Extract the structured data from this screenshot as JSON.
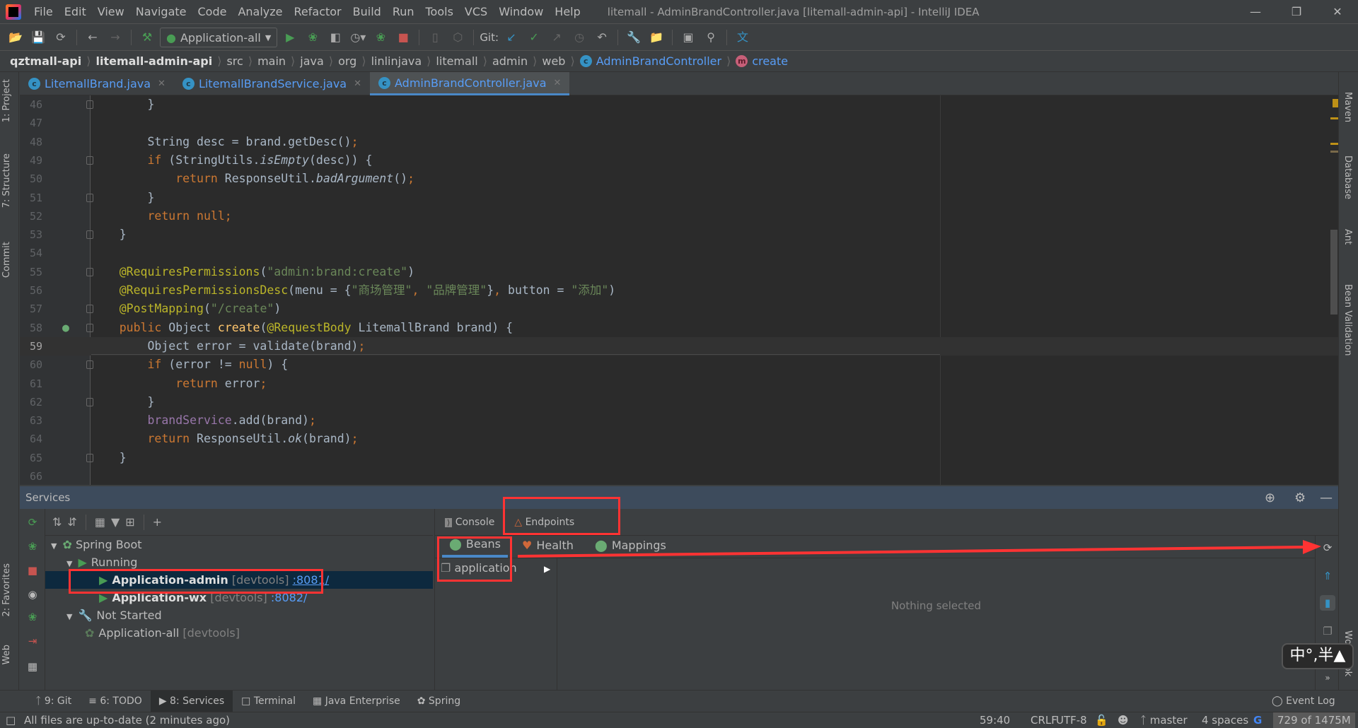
{
  "menubar": {
    "items": [
      "File",
      "Edit",
      "View",
      "Navigate",
      "Code",
      "Analyze",
      "Refactor",
      "Build",
      "Run",
      "Tools",
      "VCS",
      "Window",
      "Help"
    ],
    "title": "litemall - AdminBrandController.java [litemall-admin-api] - IntelliJ IDEA"
  },
  "toolbar": {
    "run_config": "Application-all",
    "git_label": "Git:"
  },
  "breadcrumb": [
    "qztmall-api",
    "litemall-admin-api",
    "src",
    "main",
    "java",
    "org",
    "linlinjava",
    "litemall",
    "admin",
    "web",
    "AdminBrandController",
    "create"
  ],
  "tabs": [
    {
      "label": "LitemallBrand.java"
    },
    {
      "label": "LitemallBrandService.java"
    },
    {
      "label": "AdminBrandController.java",
      "active": true
    }
  ],
  "left_strip": [
    "1: Project",
    "7: Structure",
    "Commit",
    "2: Favorites",
    "Web"
  ],
  "right_strip": [
    "Maven",
    "Database",
    "Ant",
    "Bean Validation",
    "Wordbook"
  ],
  "editor": {
    "current_line": 59,
    "lines": [
      {
        "n": 46,
        "t": [
          [
            "        }",
            ""
          ]
        ]
      },
      {
        "n": 47,
        "t": []
      },
      {
        "n": 48,
        "t": [
          [
            "        String desc = brand.getDesc()",
            ""
          ],
          [
            ";",
            "sem"
          ]
        ]
      },
      {
        "n": 49,
        "t": [
          [
            "        ",
            ""
          ],
          [
            "if",
            "kw"
          ],
          [
            " (StringUtils.",
            ""
          ],
          [
            "isEmpty",
            "it"
          ],
          [
            "(desc)) {",
            ""
          ]
        ]
      },
      {
        "n": 50,
        "t": [
          [
            "            ",
            ""
          ],
          [
            "return",
            "kw"
          ],
          [
            " ResponseUtil.",
            ""
          ],
          [
            "badArgument",
            "it"
          ],
          [
            "()",
            ""
          ],
          [
            ";",
            "sem"
          ]
        ]
      },
      {
        "n": 51,
        "t": [
          [
            "        }",
            ""
          ]
        ]
      },
      {
        "n": 52,
        "t": [
          [
            "        ",
            ""
          ],
          [
            "return null;",
            "kw"
          ]
        ]
      },
      {
        "n": 53,
        "t": [
          [
            "    }",
            ""
          ]
        ]
      },
      {
        "n": 54,
        "t": []
      },
      {
        "n": 55,
        "t": [
          [
            "    ",
            ""
          ],
          [
            "@RequiresPermissions",
            "ann"
          ],
          [
            "(",
            ""
          ],
          [
            "\"admin:brand:create\"",
            "str"
          ],
          [
            ")",
            ""
          ]
        ]
      },
      {
        "n": 56,
        "t": [
          [
            "    ",
            ""
          ],
          [
            "@RequiresPermissionsDesc",
            "ann"
          ],
          [
            "(menu = {",
            ""
          ],
          [
            "\"商场管理\"",
            "str"
          ],
          [
            ", ",
            "kw"
          ],
          [
            "\"品牌管理\"",
            "str"
          ],
          [
            "}",
            ""
          ],
          [
            ", ",
            "kw"
          ],
          [
            "button = ",
            ""
          ],
          [
            "\"添加\"",
            "str"
          ],
          [
            ")",
            ""
          ]
        ]
      },
      {
        "n": 57,
        "t": [
          [
            "    ",
            ""
          ],
          [
            "@PostMapping",
            "ann"
          ],
          [
            "(",
            ""
          ],
          [
            "\"/create\"",
            "str"
          ],
          [
            ")",
            ""
          ]
        ]
      },
      {
        "n": 58,
        "t": [
          [
            "    ",
            ""
          ],
          [
            "public",
            "kw"
          ],
          [
            " Object ",
            ""
          ],
          [
            "create",
            "fn"
          ],
          [
            "(",
            ""
          ],
          [
            "@RequestBody",
            "ann"
          ],
          [
            " LitemallBrand brand) {",
            ""
          ]
        ]
      },
      {
        "n": 59,
        "t": [
          [
            "        Object error = validate(brand)",
            ""
          ],
          [
            ";",
            "sem"
          ]
        ]
      },
      {
        "n": 60,
        "t": [
          [
            "        ",
            ""
          ],
          [
            "if",
            "kw"
          ],
          [
            " (error != ",
            ""
          ],
          [
            "null",
            "kw"
          ],
          [
            ") {",
            ""
          ]
        ]
      },
      {
        "n": 61,
        "t": [
          [
            "            ",
            ""
          ],
          [
            "return",
            "kw"
          ],
          [
            " error",
            ""
          ],
          [
            ";",
            "sem"
          ]
        ]
      },
      {
        "n": 62,
        "t": [
          [
            "        }",
            ""
          ]
        ]
      },
      {
        "n": 63,
        "t": [
          [
            "        ",
            ""
          ],
          [
            "brandService",
            "fld"
          ],
          [
            ".add(brand)",
            ""
          ],
          [
            ";",
            "sem"
          ]
        ]
      },
      {
        "n": 64,
        "t": [
          [
            "        ",
            ""
          ],
          [
            "return",
            "kw"
          ],
          [
            " ResponseUtil.",
            ""
          ],
          [
            "ok",
            "it"
          ],
          [
            "(brand)",
            ""
          ],
          [
            ";",
            "sem"
          ]
        ]
      },
      {
        "n": 65,
        "t": [
          [
            "    }",
            ""
          ]
        ]
      },
      {
        "n": 66,
        "t": []
      }
    ]
  },
  "services": {
    "title": "Services",
    "tree": {
      "spring_boot": "Spring Boot",
      "running": "Running",
      "app_admin": {
        "name": "Application-admin",
        "tag": "[devtools]",
        "port": ":8081/"
      },
      "app_wx": {
        "name": "Application-wx",
        "tag": "[devtools]",
        "port": ":8082/"
      },
      "not_started": "Not Started",
      "app_all": {
        "name": "Application-all",
        "tag": "[devtools]"
      }
    },
    "tabs": {
      "console": "Console",
      "endpoints": "Endpoints"
    },
    "endpoint_tabs": {
      "beans": "Beans",
      "health": "Health",
      "mappings": "Mappings"
    },
    "bean_context": "application",
    "empty_text": "Nothing selected"
  },
  "bottom_tabs": [
    "9: Git",
    "6: TODO",
    "8: Services",
    "Terminal",
    "Java Enterprise",
    "Spring"
  ],
  "event_log": "Event Log",
  "ime": "中°,半",
  "status": {
    "message": "All files are up-to-date (2 minutes ago)",
    "position": "59:40",
    "line_sep": "CRLF",
    "encoding": "UTF-8",
    "branch": "master",
    "indent": "4 spaces",
    "memory": "729 of 1475M"
  },
  "colors": {
    "annotation_red": "#ff3333",
    "accent": "#4a88c7",
    "selection": "#0d293e"
  }
}
